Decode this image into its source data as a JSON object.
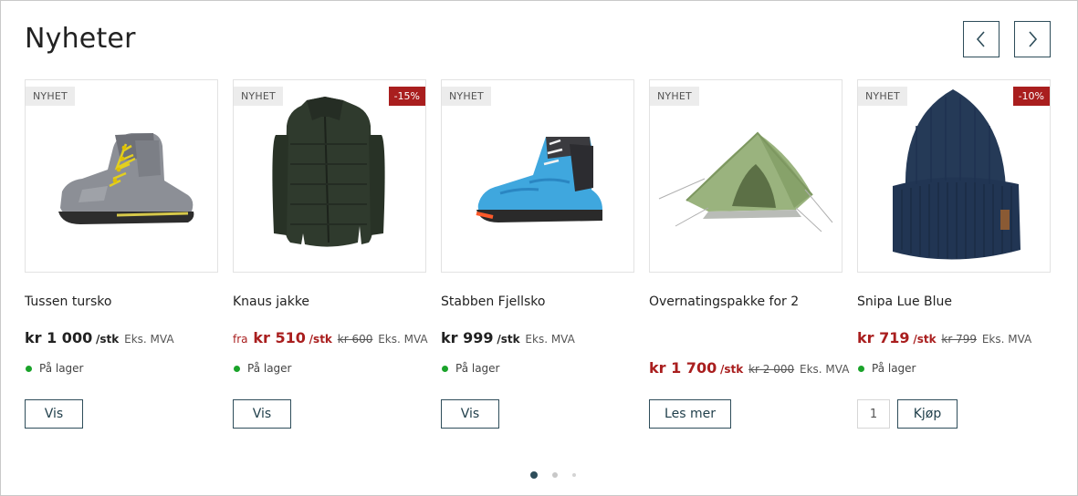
{
  "section": {
    "title": "Nyheter"
  },
  "nav": {
    "prev_icon": "chevron-left-icon",
    "next_icon": "chevron-right-icon"
  },
  "colors": {
    "accent": "#2e4d5a",
    "sale": "#a91e1e",
    "in_stock": "#1aa32a"
  },
  "products": [
    {
      "name": "Tussen tursko",
      "badge": "NYHET",
      "fra": "",
      "price": "kr 1 000",
      "unit": "/stk",
      "old_price": "",
      "mva": "Eks. MVA",
      "stock": "På lager",
      "button": "Vis"
    },
    {
      "name": "Knaus jakke",
      "badge": "NYHET",
      "discount": "-15%",
      "fra": "fra",
      "price": "kr 510",
      "unit": "/stk",
      "old_price": "kr 600",
      "mva": "Eks. MVA",
      "stock": "På lager",
      "button": "Vis"
    },
    {
      "name": "Stabben Fjellsko",
      "badge": "NYHET",
      "fra": "",
      "price": "kr 999",
      "unit": "/stk",
      "old_price": "",
      "mva": "Eks. MVA",
      "stock": "På lager",
      "button": "Vis"
    },
    {
      "name": "Overnatingspakke for 2",
      "badge": "NYHET",
      "fra": "",
      "price": "kr 1 700",
      "unit": "/stk",
      "old_price": "kr 2 000",
      "mva": "Eks. MVA",
      "stock": "",
      "button": "Les mer"
    },
    {
      "name": "Snipa Lue Blue",
      "badge": "NYHET",
      "discount": "-10%",
      "fra": "",
      "price": "kr 719",
      "unit": "/stk",
      "old_price": "kr 799",
      "mva": "Eks. MVA",
      "stock": "På lager",
      "quantity": "1",
      "button": "Kjøp"
    }
  ],
  "pagination": {
    "pages": 3,
    "active": 1
  }
}
